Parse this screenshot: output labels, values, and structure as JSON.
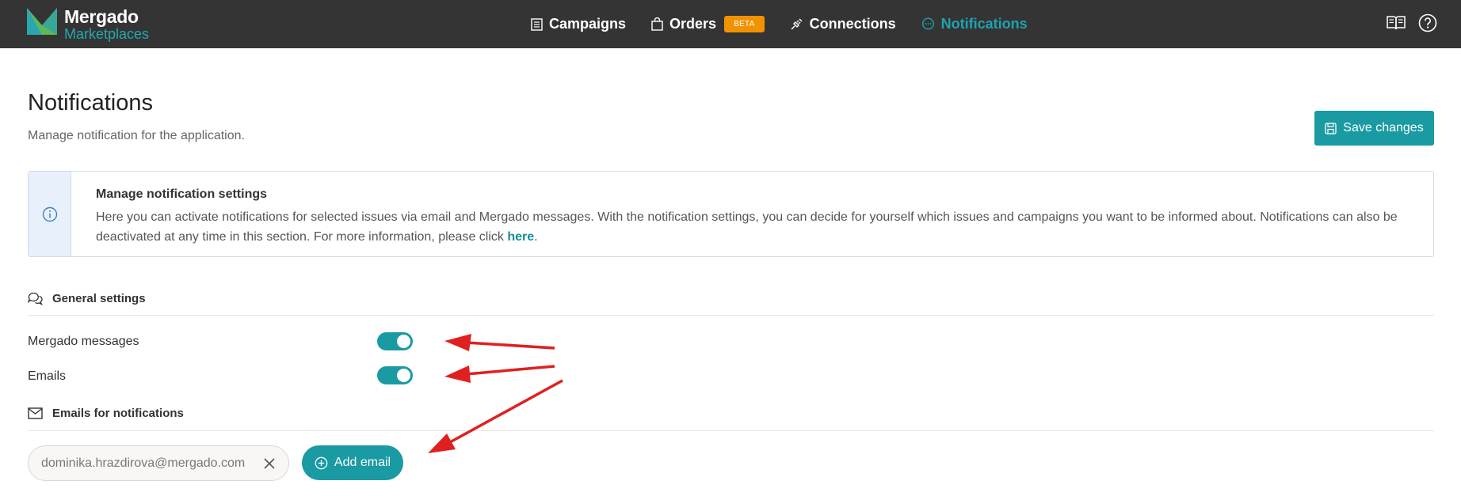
{
  "brand": {
    "name": "Mergado",
    "sub": "Marketplaces"
  },
  "nav": {
    "campaigns": "Campaigns",
    "orders": "Orders",
    "orders_badge": "BETA",
    "connections": "Connections",
    "notifications": "Notifications"
  },
  "header": {
    "title": "Notifications",
    "subtitle": "Manage notification for the application.",
    "save_label": "Save changes"
  },
  "info": {
    "title": "Manage notification settings",
    "text": "Here you can activate notifications for selected issues via email and Mergado messages. With the notification settings, you can decide for yourself which issues and campaigns you want to be informed about. Notifications can also be deactivated at any time in this section. For more information, please click ",
    "link_label": "here",
    "text_end": "."
  },
  "general": {
    "title": "General settings",
    "rows": [
      {
        "label": "Mergado messages",
        "enabled": true
      },
      {
        "label": "Emails",
        "enabled": true
      }
    ]
  },
  "emails": {
    "title": "Emails for notifications",
    "items": [
      "dominika.hrazdirova@mergado.com"
    ],
    "add_label": "Add email"
  },
  "colors": {
    "topbar": "#343434",
    "accent": "#1a9aa3",
    "beta": "#f39200",
    "annotation": "#e02020"
  }
}
